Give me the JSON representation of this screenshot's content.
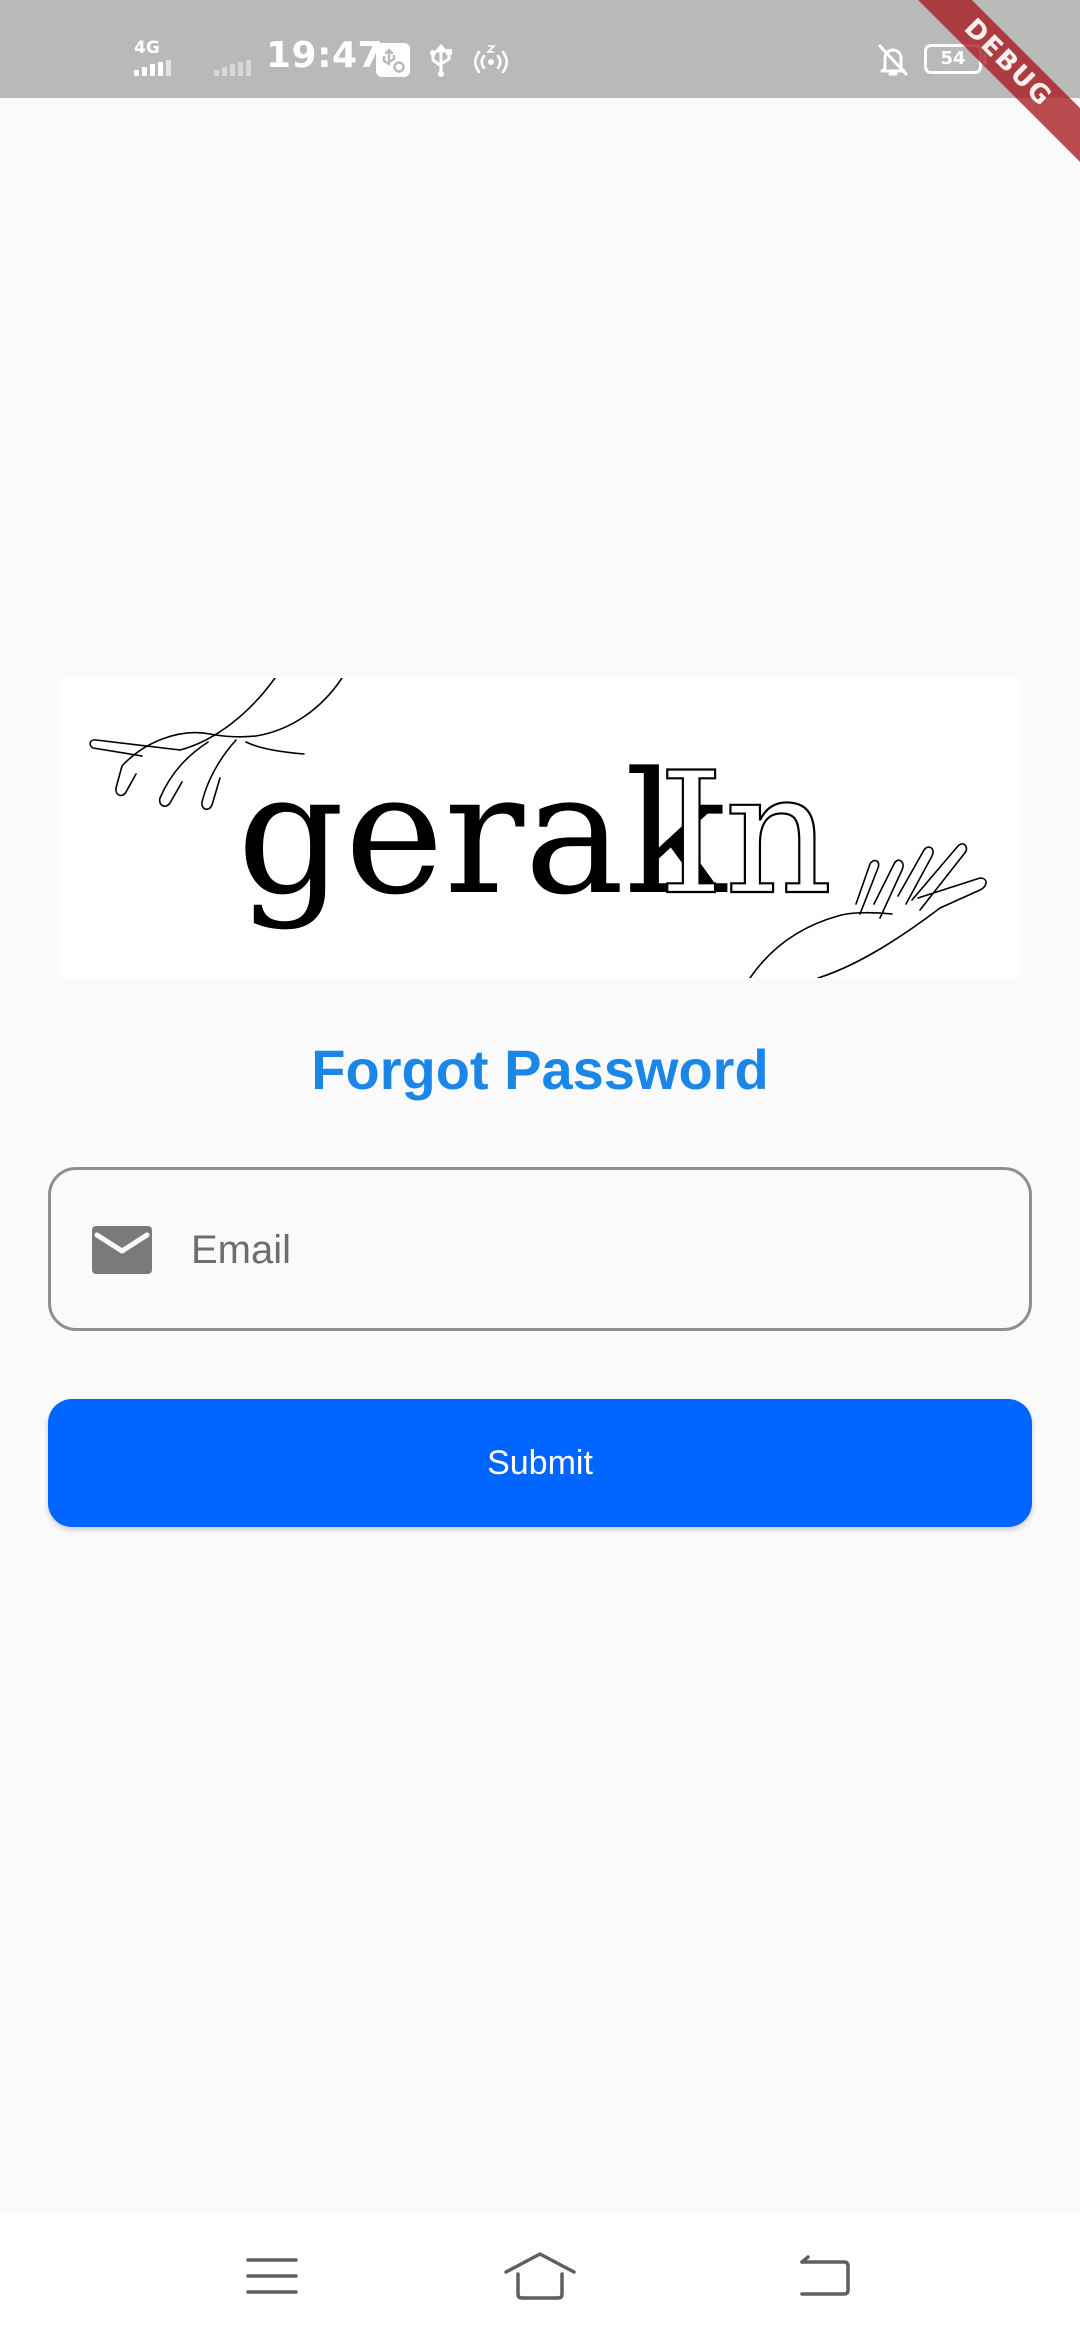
{
  "status_bar": {
    "network": "4G",
    "time": "19:47",
    "battery": "54"
  },
  "debug_banner": "DEBUG",
  "logo": {
    "wordmark": "gerakIn"
  },
  "forgot_password": {
    "title": "Forgot Password",
    "email_placeholder": "Email",
    "email_value": "",
    "submit_label": "Submit"
  },
  "colors": {
    "title": "#1a86e8",
    "submit_button": "#0166ff",
    "status_bar": "#b9b9b9",
    "background": "#fafafa"
  },
  "icons": {
    "email": "mail-icon",
    "nav": [
      "menu-icon",
      "home-icon",
      "back-icon"
    ]
  }
}
